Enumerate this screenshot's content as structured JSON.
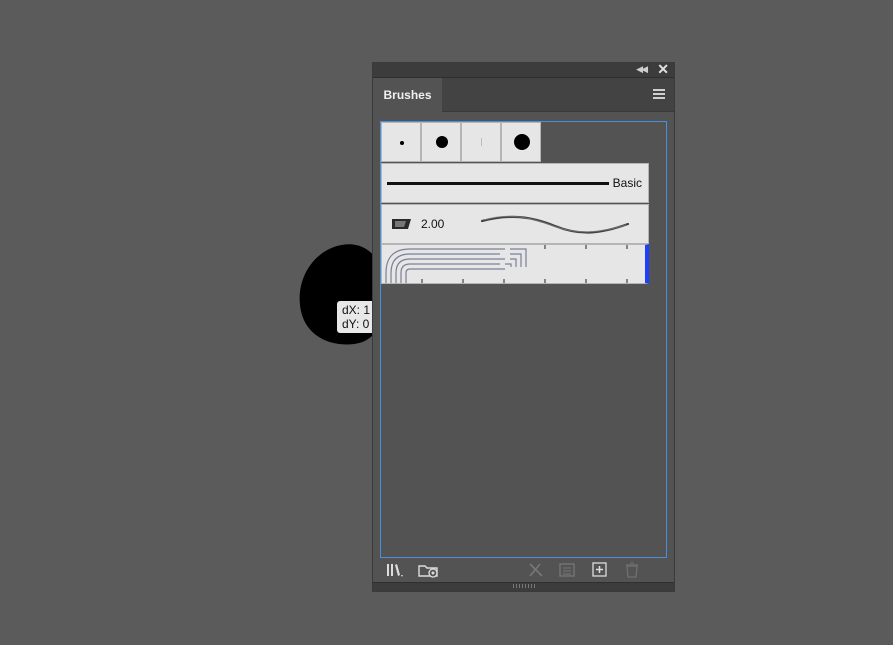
{
  "panel": {
    "tab_label": "Brushes",
    "title_buttons": [
      "collapse-icon",
      "close-icon"
    ],
    "menu_icon": "hamburger-menu-icon"
  },
  "tooltip": {
    "line1": "dX: 1",
    "line2": "dY: 0"
  },
  "brushes": {
    "swatches": [
      "small-dot",
      "medium-dot",
      "tiny-dot",
      "large-dot"
    ],
    "basic": {
      "label": "Basic"
    },
    "calligraphic": {
      "size": "2.00",
      "icon": "calligraphic-pen-icon"
    },
    "pattern": {
      "selected": true
    }
  },
  "footer": {
    "icons": [
      "brush-libraries-icon",
      "cloud-libraries-icon",
      "remove-brush-stroke-icon",
      "brush-options-icon",
      "new-brush-icon",
      "delete-brush-icon"
    ]
  },
  "colors": {
    "accent": "#4a8fdc",
    "selection": "#1f3fff",
    "panel": "#535353",
    "background": "#5b5b5b"
  }
}
